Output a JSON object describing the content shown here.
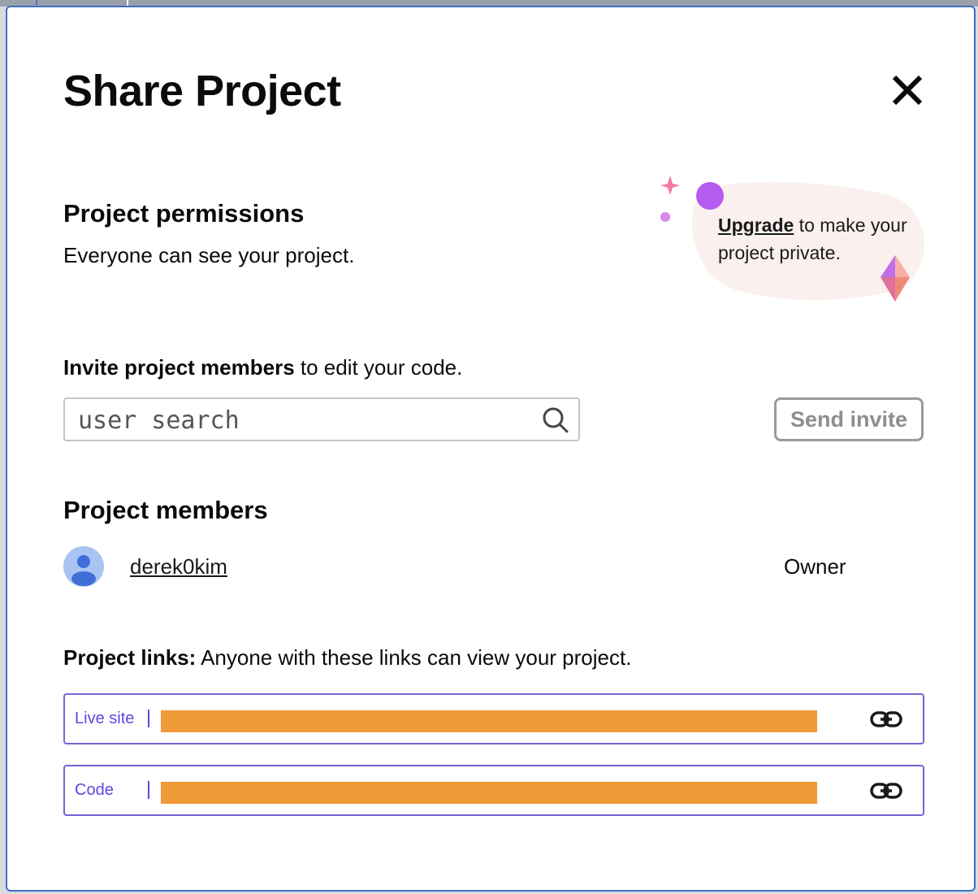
{
  "dialog": {
    "title": "Share Project"
  },
  "permissions": {
    "heading": "Project permissions",
    "description": "Everyone can see your project.",
    "upgrade_link": "Upgrade",
    "upgrade_text": " to make your project private."
  },
  "invite": {
    "label_bold": "Invite project members",
    "label_rest": " to edit your code.",
    "search_placeholder": "user search",
    "send_label": "Send invite"
  },
  "members": {
    "heading": "Project members",
    "list": [
      {
        "name": "derek0kim",
        "role": "Owner"
      }
    ]
  },
  "links": {
    "label_bold": "Project links:",
    "label_rest": " Anyone with these links can view your project.",
    "items": [
      {
        "tag": "Live site"
      },
      {
        "tag": "Code"
      }
    ]
  },
  "colors": {
    "dialog_border": "#3d6fc4",
    "link_border": "#7a62d6",
    "link_tag": "#5c48e0",
    "redaction": "#f09a38",
    "avatar_bg": "#a9c4f3",
    "avatar_fg": "#3f6fd8",
    "upgrade_bg": "#faf0ee"
  },
  "icons": [
    "close-icon",
    "search-icon",
    "sparkle-icon",
    "gem-icon",
    "user-avatar-icon",
    "link-icon"
  ]
}
